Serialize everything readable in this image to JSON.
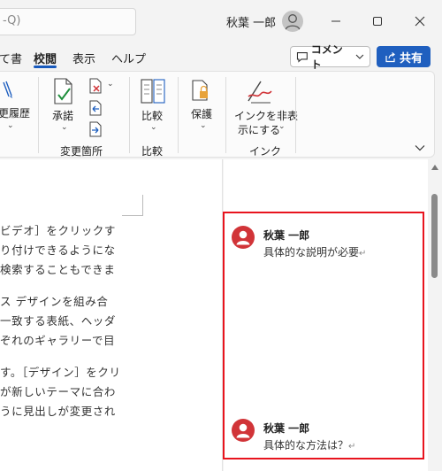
{
  "titlebar": {
    "search_fragment": "-Q)",
    "user_name": "秋葉 一郎"
  },
  "tabs": [
    {
      "label": "て書"
    },
    {
      "label": "校閲"
    },
    {
      "label": "表示"
    },
    {
      "label": "ヘルプ"
    }
  ],
  "toolbar": {
    "comment_label": "コメント",
    "share_label": "共有"
  },
  "ribbon": {
    "track_changes": "更履歴",
    "accept": "承諾",
    "group_changes": "変更箇所",
    "compare": "比較",
    "group_compare": "比較",
    "protect": "保護",
    "ink_line1": "インクを非表",
    "ink_line2": "示にする",
    "group_ink": "インク"
  },
  "document": {
    "lines": [
      {
        "text": "ビデオ］をクリックす",
        "gap_before": false
      },
      {
        "text": "り付けできるようにな",
        "gap_before": false
      },
      {
        "text": "検索することもできま",
        "gap_before": false
      },
      {
        "text": "ス デザインを組み合",
        "gap_before": true
      },
      {
        "text": "一致する表紙、ヘッダ",
        "gap_before": false
      },
      {
        "text": "ぞれのギャラリーで目",
        "gap_before": false
      },
      {
        "text": "す。［デザイン］をクリ",
        "gap_before": true
      },
      {
        "text": "が新しいテーマに合わ",
        "gap_before": false
      },
      {
        "text": "うに見出しが変更され",
        "gap_before": false
      }
    ]
  },
  "comments": [
    {
      "author": "秋葉 一郎",
      "text": "具体的な説明が必要"
    },
    {
      "author": "秋葉 一郎",
      "text": "具体的な方法は？"
    }
  ],
  "colors": {
    "accent": "#185abd",
    "share_bg": "#1f5fbf",
    "highlight_border": "#e8141e",
    "comment_avatar": "#d13438"
  }
}
